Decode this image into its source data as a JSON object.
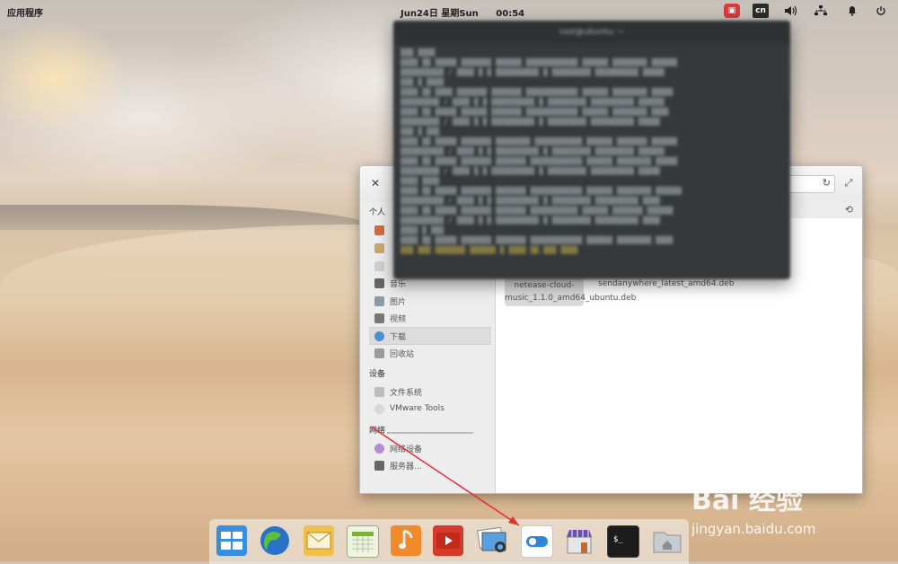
{
  "panel": {
    "apps_label": "应用程序",
    "date": "Jun24日 星期Sun",
    "time": "00:54",
    "ime_label": "cn"
  },
  "file_manager": {
    "sidebar": {
      "personal_heading": "个人",
      "personal_items": [
        "",
        "",
        "",
        "音乐",
        "图片",
        "视频",
        "下载",
        "回收站"
      ],
      "devices_heading": "设备",
      "devices_items": [
        "文件系统",
        "VMware Tools"
      ],
      "network_heading": "网络",
      "network_items": [
        "网络设备",
        "服务器..."
      ]
    },
    "files": [
      {
        "name": "netease-cloud-music_1.1.0_amd64_ubuntu.deb",
        "selected": true
      },
      {
        "name": "sendanywhere_latest_amd64.deb",
        "selected": false
      }
    ]
  },
  "terminal": {
    "title": "root@ubuntu: ~"
  },
  "dock": {
    "items": [
      "multitasking-view",
      "web-browser",
      "mail",
      "calendar",
      "music",
      "videos",
      "photos",
      "system-settings",
      "app-center",
      "terminal",
      "files"
    ]
  },
  "watermark": {
    "brand": "Bai 经验",
    "url": "jingyan.baidu.com"
  },
  "colors": {
    "annotation_arrow": "#e03030",
    "terminal_bg": "#35393b"
  }
}
